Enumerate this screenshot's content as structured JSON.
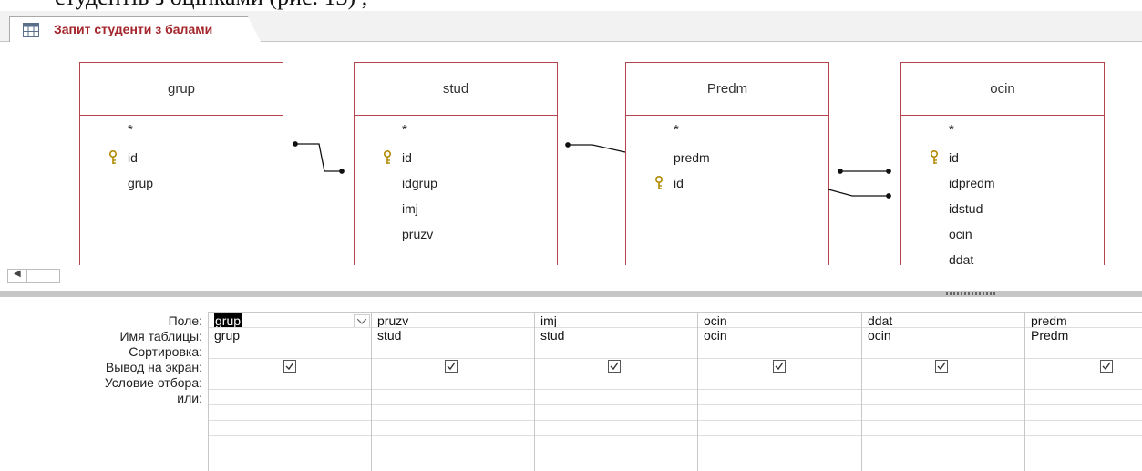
{
  "document": {
    "top_text": "студентів з оцінками (рис. 13) ,"
  },
  "tab": {
    "title": "Запит студенти з балами",
    "icon": "query-icon"
  },
  "tables": [
    {
      "name": "grup",
      "fields": [
        "*",
        "id",
        "grup"
      ],
      "key_field_index": 1
    },
    {
      "name": "stud",
      "fields": [
        "*",
        "id",
        "idgrup",
        "imj",
        "pruzv"
      ],
      "key_field_index": 1
    },
    {
      "name": "Predm",
      "fields": [
        "*",
        "predm",
        "id"
      ],
      "key_field_index": 2
    },
    {
      "name": "ocin",
      "fields": [
        "*",
        "id",
        "idpredm",
        "idstud",
        "ocin",
        "ddat"
      ],
      "key_field_index": 1
    }
  ],
  "grid": {
    "row_labels": [
      "Поле:",
      "Имя таблицы:",
      "Сортировка:",
      "Вывод на экран:",
      "Условие отбора:",
      "или:"
    ],
    "columns": [
      {
        "field": "grup",
        "table": "grup",
        "show": true
      },
      {
        "field": "pruzv",
        "table": "stud",
        "show": true
      },
      {
        "field": "imj",
        "table": "stud",
        "show": true
      },
      {
        "field": "ocin",
        "table": "ocin",
        "show": true
      },
      {
        "field": "ddat",
        "table": "ocin",
        "show": true
      },
      {
        "field": "predm",
        "table": "Predm",
        "show": true
      }
    ]
  },
  "colors": {
    "accent": "#a4262c",
    "table_border": "#b4454d"
  }
}
